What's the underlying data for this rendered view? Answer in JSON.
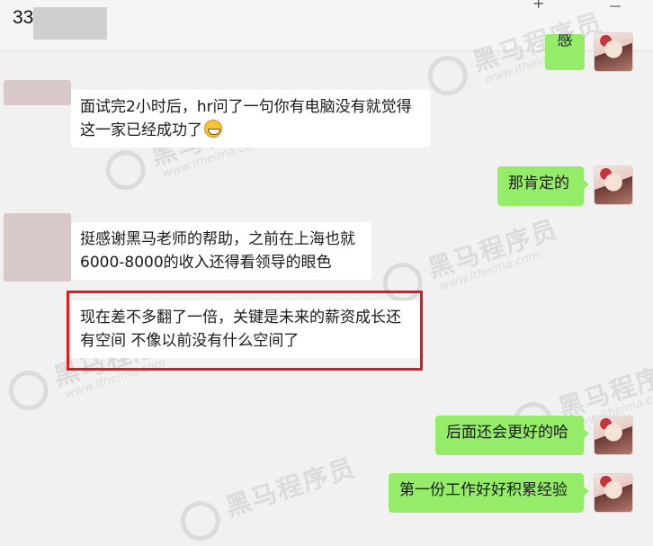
{
  "header": {
    "title": "33",
    "window_controls": [
      "+",
      "－"
    ]
  },
  "watermark": {
    "brand": "黑马程序员",
    "site": "www.itheima.com"
  },
  "messages": [
    {
      "side": "right",
      "lines": [
        "感"
      ]
    },
    {
      "side": "left",
      "lines": [
        "面试完2小时后，hr问了一句你有电脑没有就觉得",
        "这一家已经成功了"
      ],
      "emoji": "grin-emoji"
    },
    {
      "side": "right",
      "lines": [
        "那肯定的"
      ]
    },
    {
      "side": "left",
      "lines": [
        "挺感谢黑马老师的帮助，之前在上海也就",
        "6000-8000的收入还得看领导的眼色"
      ]
    },
    {
      "side": "left",
      "lines": [
        "现在差不多翻了一倍，关键是未来的薪资成长还",
        "有空间 不像以前没有什么空间了"
      ],
      "highlighted": true
    },
    {
      "side": "right",
      "lines": [
        "后面还会更好的哈"
      ]
    },
    {
      "side": "right",
      "lines": [
        "第一份工作好好积累经验"
      ]
    }
  ],
  "colors": {
    "sent_bubble": "#95ec69",
    "received_bubble": "#ffffff",
    "highlight_border": "#e5161c",
    "background": "#f1f1f1"
  }
}
